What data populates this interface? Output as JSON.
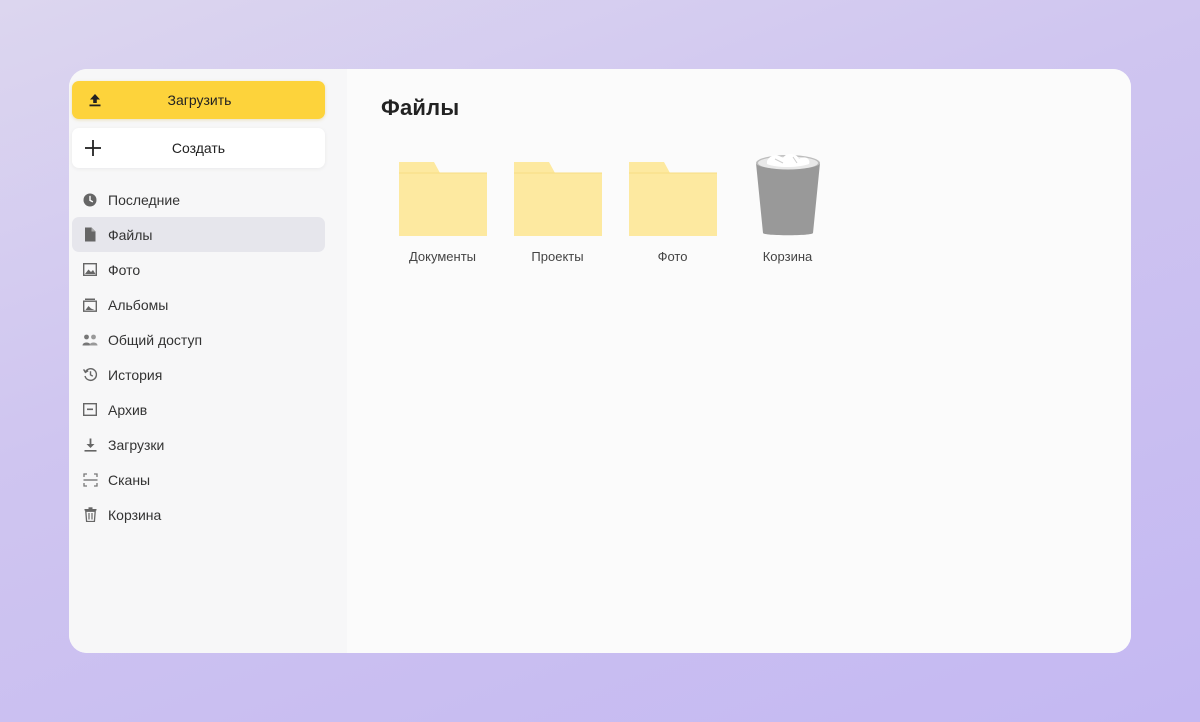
{
  "sidebar": {
    "upload_label": "Загрузить",
    "create_label": "Создать",
    "items": [
      {
        "label": "Последние",
        "icon": "clock-icon"
      },
      {
        "label": "Файлы",
        "icon": "file-icon",
        "active": true
      },
      {
        "label": "Фото",
        "icon": "image-icon"
      },
      {
        "label": "Альбомы",
        "icon": "album-icon"
      },
      {
        "label": "Общий доступ",
        "icon": "people-icon"
      },
      {
        "label": "История",
        "icon": "history-icon"
      },
      {
        "label": "Архив",
        "icon": "archive-icon"
      },
      {
        "label": "Загрузки",
        "icon": "download-icon"
      },
      {
        "label": "Сканы",
        "icon": "scan-icon"
      },
      {
        "label": "Корзина",
        "icon": "trash-icon"
      }
    ]
  },
  "main": {
    "title": "Файлы",
    "items": [
      {
        "label": "Документы",
        "type": "folder"
      },
      {
        "label": "Проекты",
        "type": "folder"
      },
      {
        "label": "Фото",
        "type": "folder"
      },
      {
        "label": "Корзина",
        "type": "trash"
      }
    ]
  },
  "colors": {
    "accent": "#fdd33b",
    "folder": "#fde9a0",
    "active_nav": "#e6e6ec"
  }
}
